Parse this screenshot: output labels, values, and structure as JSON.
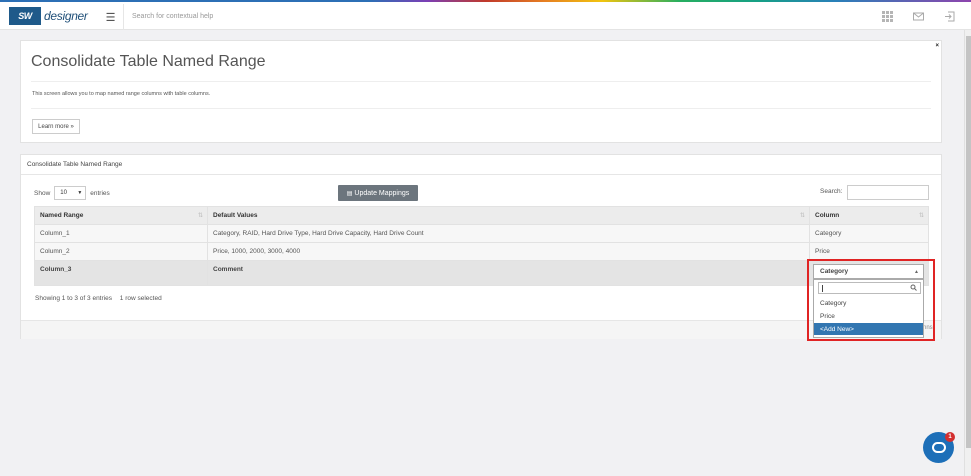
{
  "topbar": {
    "logo_mark": "SW",
    "logo_text": "designer",
    "menu_icon": "hamburger-icon",
    "search_placeholder": "Search for contextual help",
    "icons": [
      "apps-grid-icon",
      "mail-icon",
      "logout-icon"
    ]
  },
  "intro": {
    "title": "Consolidate Table Named Range",
    "description": "This screen allows you to map named range columns with table columns.",
    "learn_more": "Learn more »",
    "close": "×"
  },
  "mapping": {
    "panel_title": "Consolidate Table Named Range",
    "show_label": "Show",
    "entries_value": "10",
    "entries_label": "entries",
    "update_button": "Update Mappings",
    "search_label": "Search:",
    "columns": [
      "Named Range",
      "Default Values",
      "Column"
    ],
    "rows": [
      {
        "named_range": "Column_1",
        "default_values": "Category, RAID, Hard Drive Type, Hard Drive Capacity, Hard Drive Count",
        "column": "Category"
      },
      {
        "named_range": "Column_2",
        "default_values": "Price, 1000, 2000, 3000, 4000",
        "column": "Price"
      },
      {
        "named_range": "Column_3",
        "default_values": "Comment",
        "column": ""
      }
    ],
    "info": "Showing 1 to 3 of 3 entries",
    "selected_info": "1 row selected",
    "cut_text": "nns"
  },
  "dropdown": {
    "selected": "Category",
    "search_value": "",
    "options": [
      "Category",
      "Price",
      "<Add New>"
    ],
    "active_index": 2
  },
  "chat": {
    "badge_count": "1"
  },
  "colors": {
    "brand": "#1f5a8a",
    "update_button": "#6c757d",
    "option_active": "#3276b1",
    "highlight": "#e02424",
    "chat": "#1d6fb8"
  }
}
